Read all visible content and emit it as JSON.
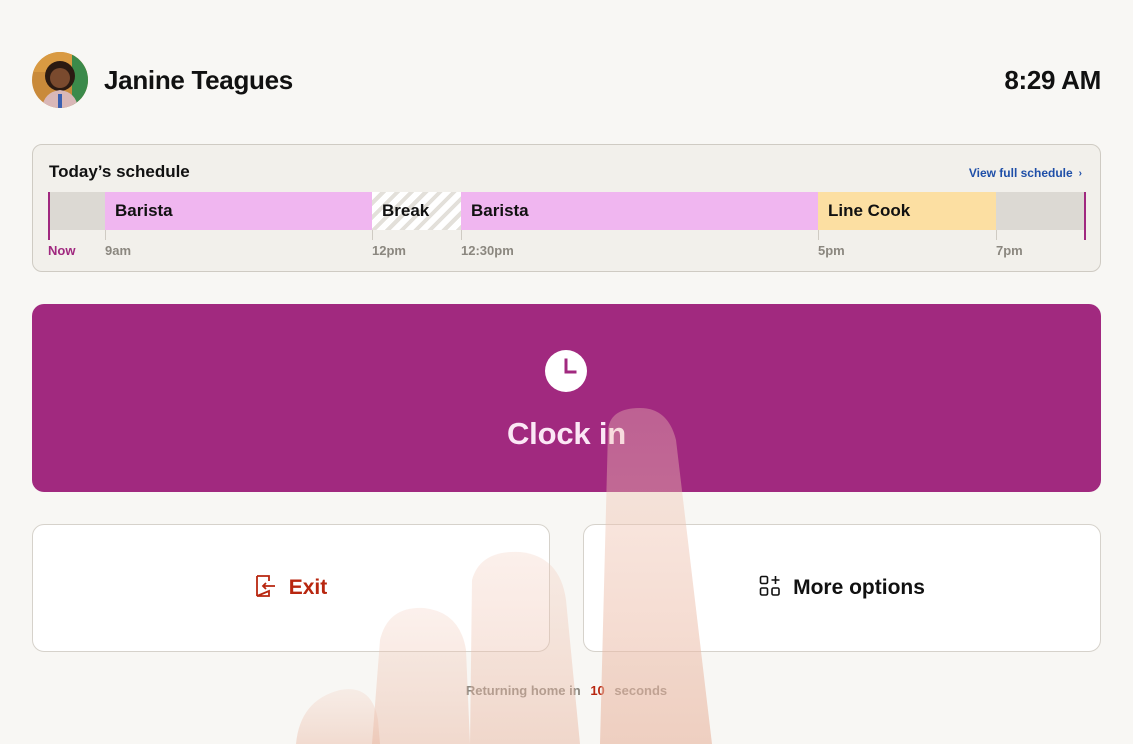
{
  "user": {
    "name": "Janine Teagues"
  },
  "clock": {
    "time": "8:29 AM"
  },
  "schedule": {
    "title": "Today’s schedule",
    "view_link": "View full schedule",
    "segments": [
      {
        "label": "Barista",
        "kind": "shift",
        "color": "#f0b6f0"
      },
      {
        "label": "Break",
        "kind": "break"
      },
      {
        "label": "Barista",
        "kind": "shift",
        "color": "#f0b6f0"
      },
      {
        "label": "Line Cook",
        "kind": "shift",
        "color": "#fcdfa2"
      }
    ],
    "ticks": [
      "Now",
      "9am",
      "12pm",
      "12:30pm",
      "5pm",
      "7pm"
    ]
  },
  "clock_in": {
    "label": "Clock in",
    "icon": "clock-icon",
    "color": "#a1297f"
  },
  "actions": {
    "exit": {
      "label": "Exit",
      "icon": "exit-door-icon",
      "color": "#b8260f"
    },
    "more": {
      "label": "More options",
      "icon": "grid-plus-icon"
    }
  },
  "footer": {
    "prefix": "Returning home in",
    "countdown": "10",
    "suffix": "seconds"
  }
}
